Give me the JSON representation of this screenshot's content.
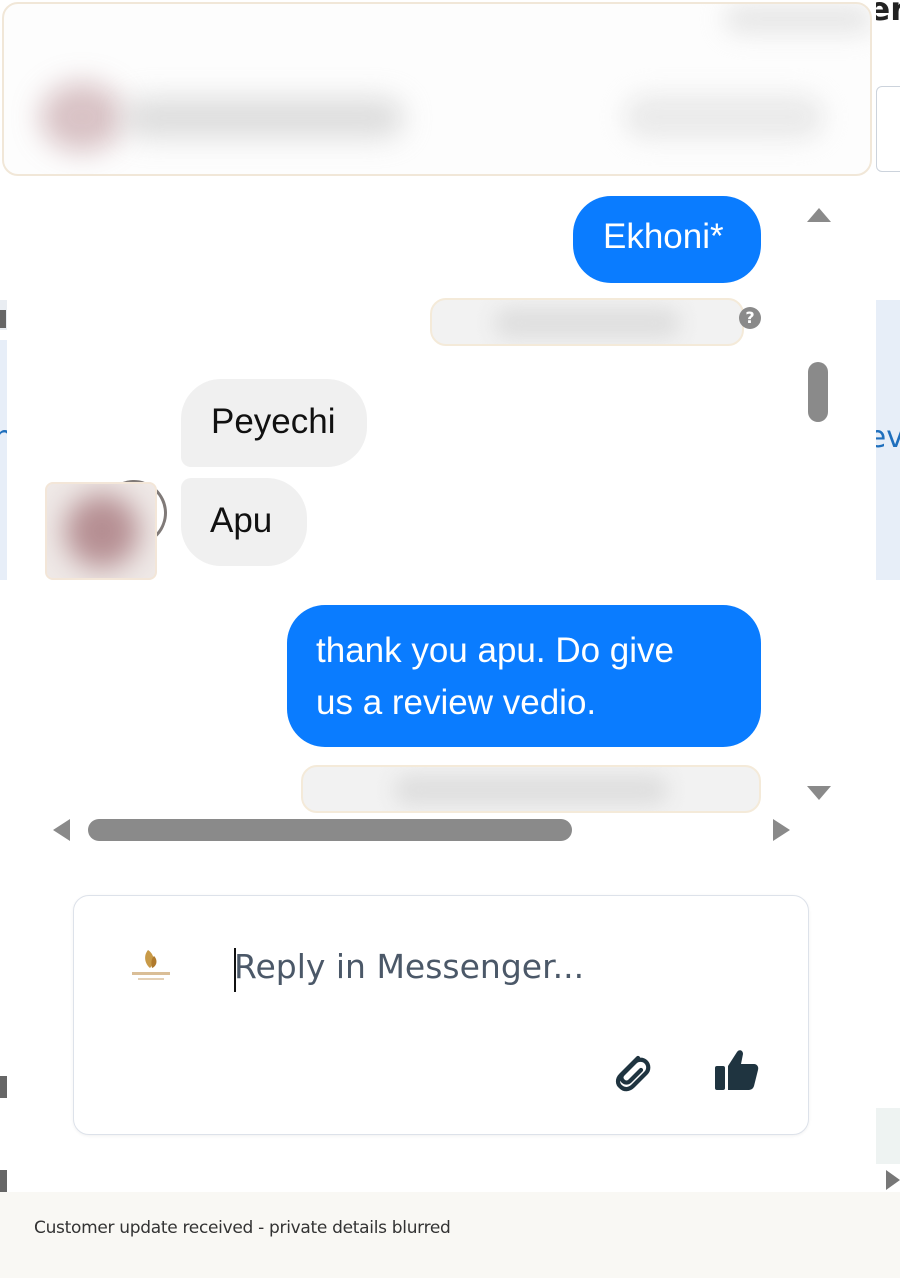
{
  "background": {
    "left_edge_text": "n",
    "right_edge_text": "ev",
    "corner_text": "er"
  },
  "conversation": {
    "messages": [
      {
        "direction": "outgoing",
        "text": "Ekhoni*"
      },
      {
        "direction": "incoming",
        "text": "Peyechi"
      },
      {
        "direction": "incoming",
        "text": "Apu"
      },
      {
        "direction": "outgoing",
        "lines": [
          "thank you apu. Do give",
          "us a review vedio."
        ]
      }
    ],
    "help_icon": "?"
  },
  "reply": {
    "placeholder": "Reply in Messenger...",
    "attach_icon": "paperclip-icon",
    "like_icon": "thumbs-up-icon"
  },
  "footer": {
    "text": "Customer update received - private details blurred"
  },
  "colors": {
    "outgoing_bubble": "#0a7cff",
    "incoming_bubble": "#f0f0f0",
    "footer_bg": "#f9f8f4"
  }
}
